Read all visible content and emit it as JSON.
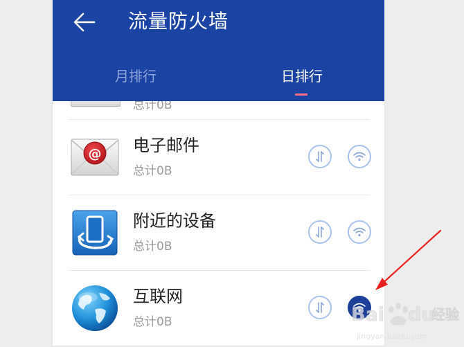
{
  "header": {
    "title": "流量防火墙",
    "tabs": [
      {
        "label": "月排行",
        "active": false
      },
      {
        "label": "日排行",
        "active": true
      }
    ]
  },
  "colors": {
    "appbar": "#1a43a3",
    "tab_indicator": "#ff6f8b",
    "button_outline": "#a9c3ee",
    "button_active": "#1c3f97",
    "annotation_arrow": "#e8231f"
  },
  "list": {
    "partial_item": {
      "total": "总计0B"
    },
    "items": [
      {
        "name": "电子邮件",
        "total": "总计0B",
        "icon": "email-app-icon",
        "data_toggle": "on",
        "wifi_toggle": "on"
      },
      {
        "name": "附近的设备",
        "total": "总计0B",
        "icon": "nearby-devices-app-icon",
        "data_toggle": "on",
        "wifi_toggle": "on"
      },
      {
        "name": "互联网",
        "total": "总计0B",
        "icon": "globe-browser-app-icon",
        "data_toggle": "on",
        "wifi_toggle": "blocked"
      }
    ]
  },
  "watermark": {
    "text_left": "Bai",
    "text_right": "du",
    "brand_cn": "经验",
    "url": "jingyan.baidu.com"
  }
}
